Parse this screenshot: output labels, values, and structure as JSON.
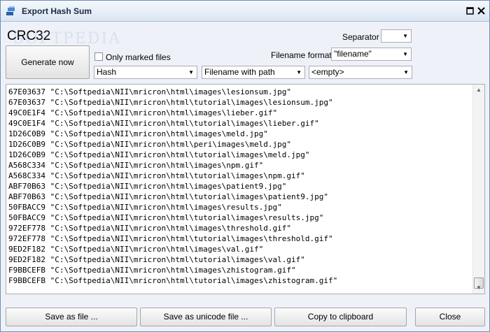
{
  "window": {
    "title": "Export Hash Sum"
  },
  "header": {
    "hash_type": "CRC32",
    "watermark": "SOFTPEDIA"
  },
  "generate_button": "Generate now",
  "only_marked": {
    "label": "Only marked files",
    "checked": false
  },
  "separator": {
    "label": "Separator",
    "value": ""
  },
  "filename_format": {
    "label": "Filename format",
    "value": "\"filename\""
  },
  "selectors": {
    "column1": "Hash",
    "column2": "Filename with path",
    "column3": "<empty>"
  },
  "output_lines": [
    "67E03637 \"C:\\Softpedia\\NII\\mricron\\html\\images\\lesionsum.jpg\"",
    "67E03637 \"C:\\Softpedia\\NII\\mricron\\html\\tutorial\\images\\lesionsum.jpg\"",
    "49C0E1F4 \"C:\\Softpedia\\NII\\mricron\\html\\images\\lieber.gif\"",
    "49C0E1F4 \"C:\\Softpedia\\NII\\mricron\\html\\tutorial\\images\\lieber.gif\"",
    "1D26C0B9 \"C:\\Softpedia\\NII\\mricron\\html\\images\\meld.jpg\"",
    "1D26C0B9 \"C:\\Softpedia\\NII\\mricron\\html\\peri\\images\\meld.jpg\"",
    "1D26C0B9 \"C:\\Softpedia\\NII\\mricron\\html\\tutorial\\images\\meld.jpg\"",
    "A568C334 \"C:\\Softpedia\\NII\\mricron\\html\\images\\npm.gif\"",
    "A568C334 \"C:\\Softpedia\\NII\\mricron\\html\\tutorial\\images\\npm.gif\"",
    "ABF70B63 \"C:\\Softpedia\\NII\\mricron\\html\\images\\patient9.jpg\"",
    "ABF70B63 \"C:\\Softpedia\\NII\\mricron\\html\\tutorial\\images\\patient9.jpg\"",
    "50FBACC9 \"C:\\Softpedia\\NII\\mricron\\html\\images\\results.jpg\"",
    "50FBACC9 \"C:\\Softpedia\\NII\\mricron\\html\\tutorial\\images\\results.jpg\"",
    "972EF778 \"C:\\Softpedia\\NII\\mricron\\html\\images\\threshold.gif\"",
    "972EF778 \"C:\\Softpedia\\NII\\mricron\\html\\tutorial\\images\\threshold.gif\"",
    "9ED2F182 \"C:\\Softpedia\\NII\\mricron\\html\\images\\val.gif\"",
    "9ED2F182 \"C:\\Softpedia\\NII\\mricron\\html\\tutorial\\images\\val.gif\"",
    "F9BBCEFB \"C:\\Softpedia\\NII\\mricron\\html\\images\\zhistogram.gif\"",
    "F9BBCEFB \"C:\\Softpedia\\NII\\mricron\\html\\tutorial\\images\\zhistogram.gif\""
  ],
  "buttons": {
    "save_file": "Save as file ...",
    "save_unicode": "Save as unicode file ...",
    "copy_clipboard": "Copy to clipboard",
    "close": "Close"
  },
  "icons": {
    "app": "hash-app-icon",
    "maximize": "maximize-icon",
    "close": "close-icon",
    "dropdown": "chevron-down-icon"
  },
  "colors": {
    "titlebar": "#dbe6f3",
    "border": "#6f8fb4",
    "app_icon": "#2b5fa8"
  }
}
